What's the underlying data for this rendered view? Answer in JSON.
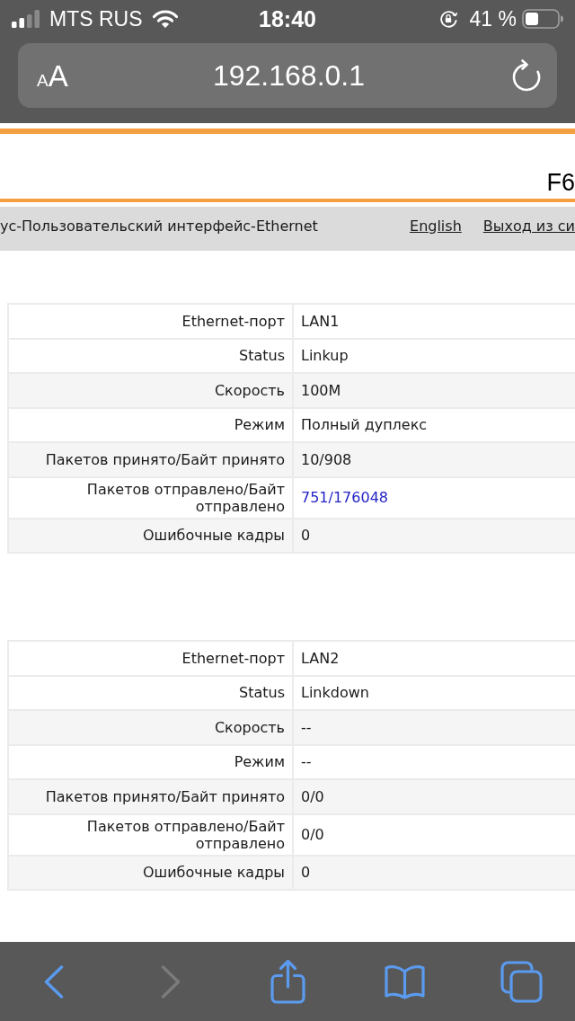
{
  "status_bar": {
    "carrier": "MTS RUS",
    "time": "18:40",
    "battery": "41 %"
  },
  "address_bar": {
    "text_size": {
      "small": "A",
      "large": "A"
    },
    "url": "192.168.0.1"
  },
  "page_header": {
    "title": "F6"
  },
  "nav_bar": {
    "breadcrumb": "ус-Пользовательский интерфейс-Ethernet",
    "links": [
      "English",
      "Выход из си"
    ]
  },
  "port_tables": [
    {
      "rows": [
        {
          "label": "Ethernet-порт",
          "value": "LAN1",
          "linked": false
        },
        {
          "label": "Status",
          "value": "Linkup",
          "linked": false
        },
        {
          "label": "Скорость",
          "value": "100M",
          "linked": false
        },
        {
          "label": "Режим",
          "value": "Полный дуплекс",
          "linked": false
        },
        {
          "label": "Пакетов принято/Байт принято",
          "value": "10/908",
          "linked": false
        },
        {
          "label": "Пакетов отправлено/Байт отправлено",
          "value": "751/176048",
          "linked": true
        },
        {
          "label": "Ошибочные кадры",
          "value": "0",
          "linked": false
        }
      ]
    },
    {
      "rows": [
        {
          "label": "Ethernet-порт",
          "value": "LAN2",
          "linked": false
        },
        {
          "label": "Status",
          "value": "Linkdown",
          "linked": false
        },
        {
          "label": "Скорость",
          "value": "--",
          "linked": false
        },
        {
          "label": "Режим",
          "value": "--",
          "linked": false
        },
        {
          "label": "Пакетов принято/Байт принято",
          "value": "0/0",
          "linked": false
        },
        {
          "label": "Пакетов отправлено/Байт отправлено",
          "value": "0/0",
          "linked": false
        },
        {
          "label": "Ошибочные кадры",
          "value": "0",
          "linked": false
        }
      ]
    }
  ],
  "toolbar": {
    "buttons": [
      {
        "kind": "back",
        "disabled": false
      },
      {
        "kind": "forward",
        "disabled": true
      },
      {
        "kind": "share",
        "disabled": false
      },
      {
        "kind": "bookmarks",
        "disabled": false
      },
      {
        "kind": "tabs",
        "disabled": false
      }
    ]
  }
}
